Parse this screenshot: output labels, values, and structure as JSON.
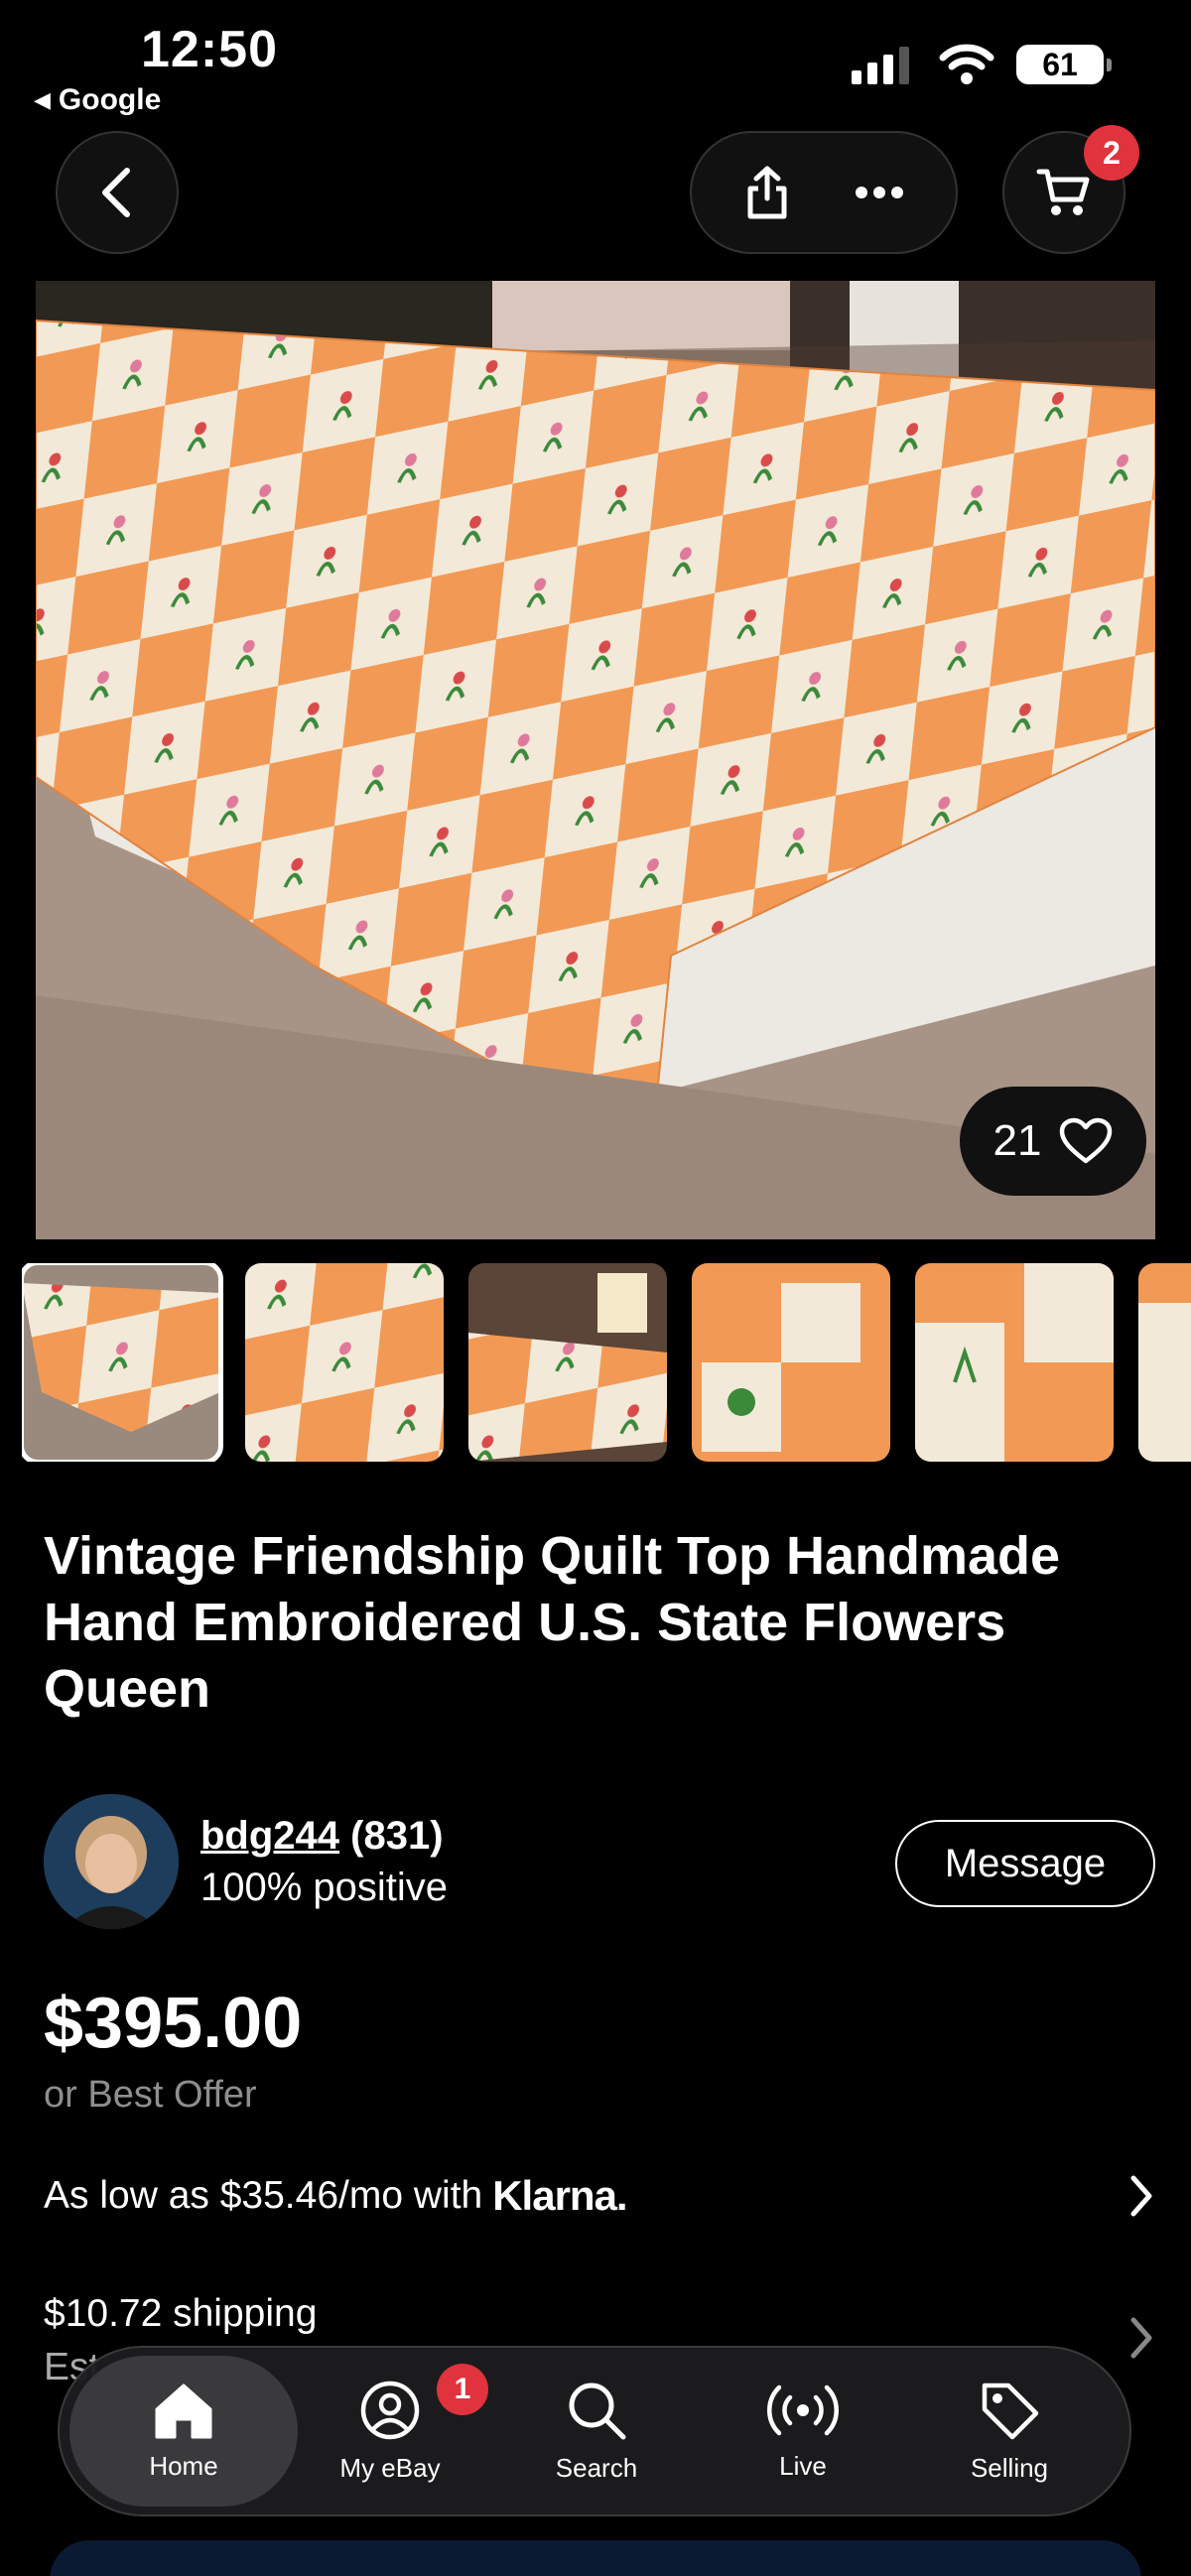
{
  "status_bar": {
    "time": "12:50",
    "back_app": "Google",
    "battery": "61"
  },
  "header": {
    "cart_count": "2"
  },
  "listing": {
    "like_count": "21",
    "title": "Vintage Friendship Quilt Top Handmade Hand Embroidered U.S. State Flowers Queen",
    "seller": {
      "username": "bdg244",
      "feedback_count": "(831)",
      "positive": "100% positive",
      "message_label": "Message"
    },
    "price": "$395.00",
    "best_offer": "or Best Offer",
    "financing": {
      "text": "As low as $35.46/mo with",
      "provider": "Klarna."
    },
    "shipping": {
      "cost": "$10.72 shipping",
      "sub": "Est"
    }
  },
  "tabbar": {
    "items": [
      {
        "label": "Home",
        "icon": "home-icon"
      },
      {
        "label": "My eBay",
        "icon": "account-icon",
        "badge": "1"
      },
      {
        "label": "Search",
        "icon": "search-icon"
      },
      {
        "label": "Live",
        "icon": "live-icon"
      },
      {
        "label": "Selling",
        "icon": "tag-icon"
      }
    ]
  },
  "colors": {
    "accent_badge": "#e0333e",
    "quilt_orange": "#f29a55",
    "background": "#000000"
  }
}
